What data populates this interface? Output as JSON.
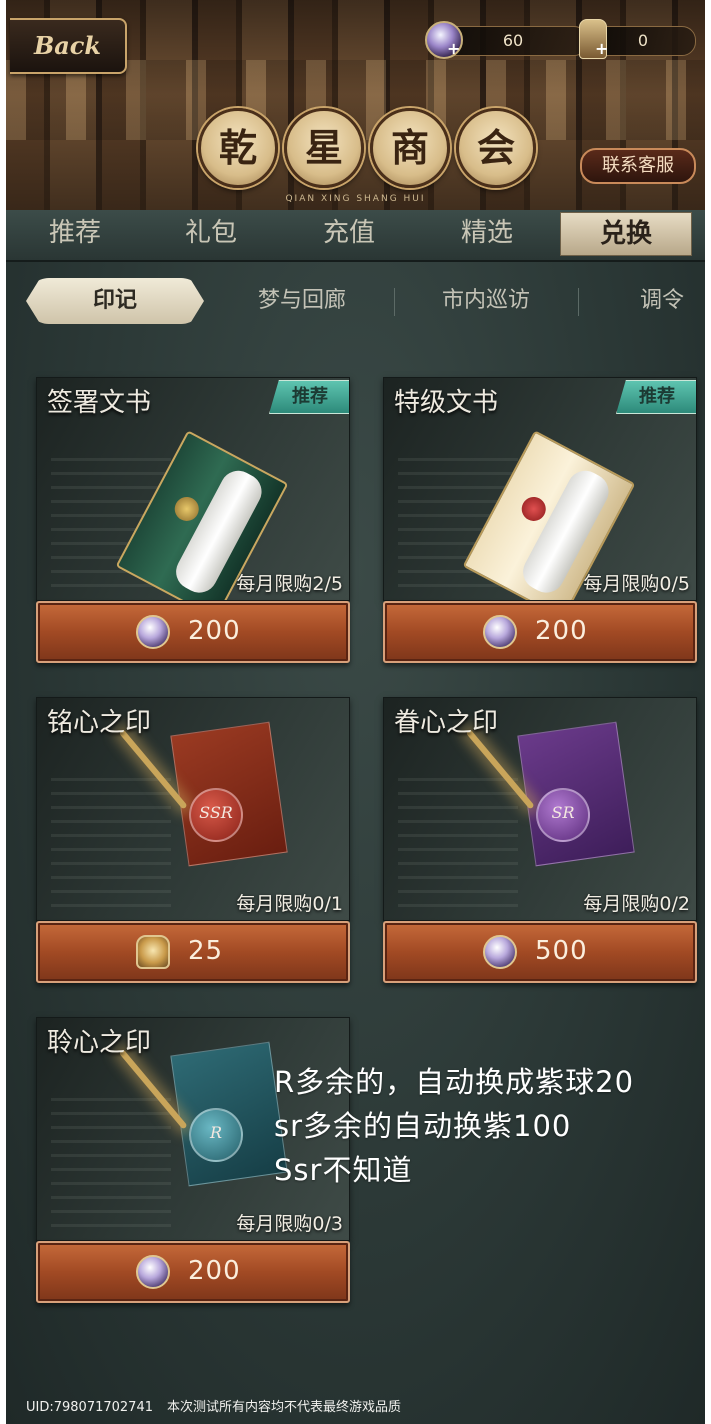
{
  "header": {
    "back_label": "Back",
    "currencies": [
      {
        "icon": "purple-orb-icon",
        "value": "60"
      },
      {
        "icon": "seal-token-icon",
        "value": "0"
      }
    ],
    "title_chars": [
      "乾",
      "星",
      "商",
      "会"
    ],
    "title_pinyin": "QIAN XING SHANG HUI",
    "service_label": "联系客服"
  },
  "tabs": [
    {
      "label": "推荐",
      "active": false
    },
    {
      "label": "礼包",
      "active": false
    },
    {
      "label": "充值",
      "active": false
    },
    {
      "label": "精选",
      "active": false
    },
    {
      "label": "兑换",
      "active": true
    }
  ],
  "subtabs": [
    {
      "label": "印记",
      "active": true
    },
    {
      "label": "梦与回廊",
      "active": false
    },
    {
      "label": "市内巡访",
      "active": false
    },
    {
      "label": "调令",
      "active": false
    }
  ],
  "items": [
    {
      "name": "签署文书",
      "badge": "推荐",
      "limit": "每月限购2/5",
      "price": "200",
      "currency_icon": "purple-orb-icon",
      "art": "green-document-box"
    },
    {
      "name": "特级文书",
      "badge": "推荐",
      "limit": "每月限购0/5",
      "price": "200",
      "currency_icon": "purple-orb-icon",
      "art": "cream-document-box"
    },
    {
      "name": "铭心之印",
      "badge": "",
      "limit": "每月限购0/1",
      "price": "25",
      "currency_icon": "feather-token-icon",
      "art": "red-letter",
      "seal": "SSR"
    },
    {
      "name": "眷心之印",
      "badge": "",
      "limit": "每月限购0/2",
      "price": "500",
      "currency_icon": "purple-orb-icon",
      "art": "purple-letter",
      "seal": "SR"
    },
    {
      "name": "聆心之印",
      "badge": "",
      "limit": "每月限购0/3",
      "price": "200",
      "currency_icon": "purple-orb-icon",
      "art": "teal-letter",
      "seal": "R"
    }
  ],
  "note": {
    "lines": [
      "R多余的，自动换成紫球20",
      "sr多余的自动换紫100",
      "Ssr不知道"
    ]
  },
  "footer": {
    "uid": "UID:798071702741",
    "disclaimer": "本次测试所有内容均不代表最终游戏品质"
  }
}
